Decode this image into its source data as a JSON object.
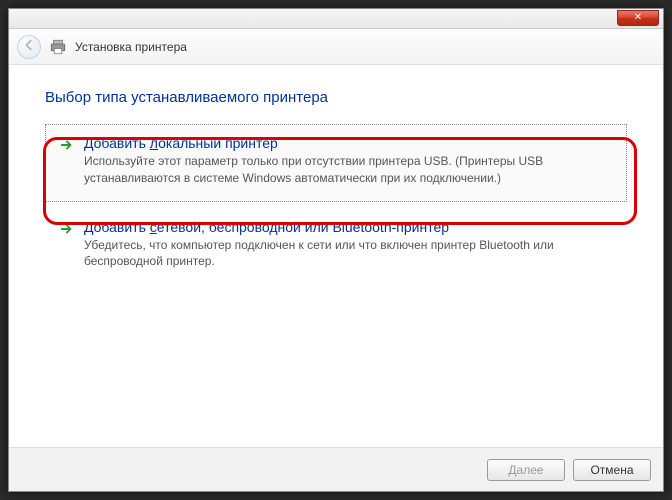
{
  "titlebar": {
    "close_glyph": "✕"
  },
  "header": {
    "title": "Установка принтера"
  },
  "heading": "Выбор типа устанавливаемого принтера",
  "options": [
    {
      "title_pre": "Добавить ",
      "title_u": "л",
      "title_post": "окальный принтер",
      "desc": "Используйте этот параметр только при отсутствии принтера USB. (Принтеры USB устанавливаются в системе Windows автоматически при их подключении.)"
    },
    {
      "title_pre": "Добавить ",
      "title_u": "с",
      "title_post": "етевой, беспроводной или Bluetooth-принтер",
      "desc": "Убедитесь, что компьютер подключен к сети или что включен принтер Bluetooth или беспроводной принтер."
    }
  ],
  "footer": {
    "next_u": "Д",
    "next_post": "алее",
    "cancel": "Отмена"
  }
}
